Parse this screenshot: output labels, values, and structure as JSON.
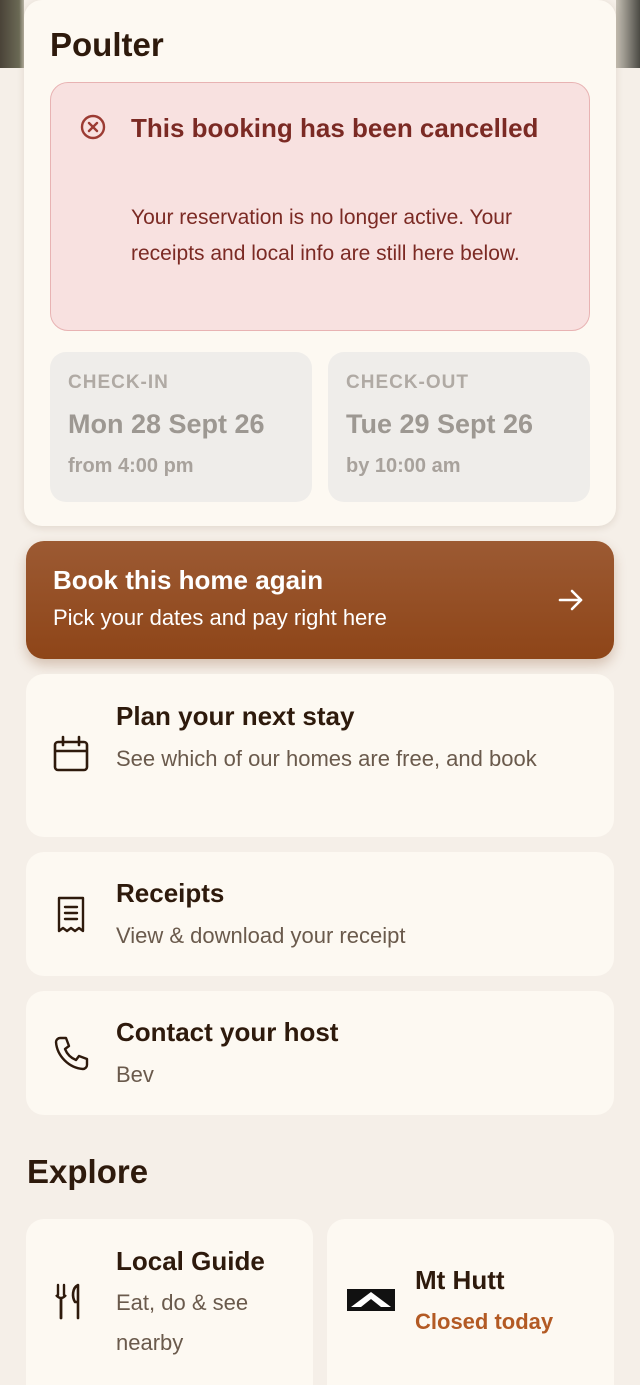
{
  "property": {
    "name": "Poulter"
  },
  "cancellation": {
    "title": "This booking has been cancelled",
    "message": "Your reservation is no longer active. Your receipts and local info are still here below."
  },
  "stay": {
    "checkin": {
      "label": "CHECK-IN",
      "date": "Mon 28 Sept 26",
      "time": "from 4:00 pm"
    },
    "checkout": {
      "label": "CHECK-OUT",
      "date": "Tue 29 Sept 26",
      "time": "by 10:00 am"
    }
  },
  "book_again": {
    "title": "Book this home again",
    "subtitle": "Pick your dates and pay right here"
  },
  "actions": {
    "plan": {
      "title": "Plan your next stay",
      "subtitle": "See which of our homes are free, and book"
    },
    "receipts": {
      "title": "Receipts",
      "subtitle": "View & download your receipt"
    },
    "contact": {
      "title": "Contact your host",
      "subtitle": "Bev"
    }
  },
  "explore": {
    "heading": "Explore",
    "local_guide": {
      "title": "Local Guide",
      "subtitle": "Eat, do & see nearby"
    },
    "mt_hutt": {
      "title": "Mt Hutt",
      "status": "Closed today"
    }
  },
  "icons": {
    "cancel": "x-circle-icon",
    "arrow": "arrow-right-icon",
    "calendar": "calendar-icon",
    "receipt": "receipt-icon",
    "phone": "phone-icon",
    "cutlery": "cutlery-icon",
    "mountain": "mountain-icon"
  },
  "colors": {
    "accent": "#8e4518",
    "cancel_text": "#7b2a24",
    "cancel_bg": "#f8e1e0",
    "status_closed": "#b35a24",
    "page_bg": "#f5efe8"
  }
}
